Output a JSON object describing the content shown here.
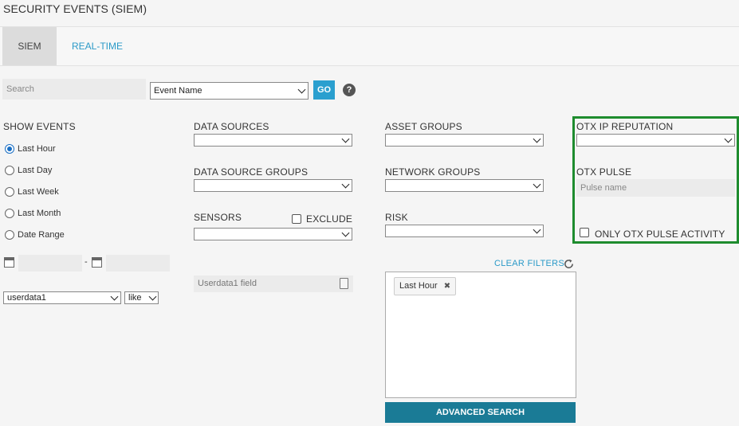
{
  "page": {
    "title": "SECURITY EVENTS (SIEM)"
  },
  "tabs": {
    "siem": "SIEM",
    "realtime": "REAL-TIME"
  },
  "search": {
    "placeholder": "Search",
    "field_select": "Event Name",
    "go": "GO",
    "help": "?"
  },
  "show_events": {
    "label": "SHOW EVENTS",
    "options": [
      "Last Hour",
      "Last Day",
      "Last Week",
      "Last Month",
      "Date Range"
    ],
    "selected": "Last Hour",
    "date_separator": "-"
  },
  "userdata": {
    "select": "userdata1",
    "operator": "like",
    "field_placeholder": "Userdata1 field"
  },
  "filters": {
    "data_sources": "DATA SOURCES",
    "data_source_groups": "DATA SOURCE GROUPS",
    "sensors": "SENSORS",
    "exclude": "EXCLUDE",
    "asset_groups": "ASSET GROUPS",
    "network_groups": "NETWORK GROUPS",
    "risk": "RISK"
  },
  "otx": {
    "ip_reputation": "OTX IP REPUTATION",
    "pulse": "OTX PULSE",
    "pulse_placeholder": "Pulse name",
    "only_pulse_activity": "ONLY OTX PULSE ACTIVITY",
    "frame_color": "#1e8c2e"
  },
  "active_filters": {
    "clear": "CLEAR FILTERS",
    "tags": [
      "Last Hour"
    ]
  },
  "advanced_search": "ADVANCED SEARCH",
  "colors": {
    "accent": "#2a9fcf",
    "link": "#2b9ac8",
    "button_dark": "#1a7b96",
    "radio": "#1a6fc4"
  }
}
